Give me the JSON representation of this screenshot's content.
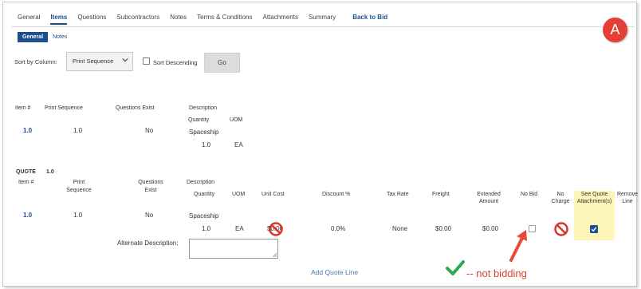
{
  "tabs": [
    {
      "label": "General"
    },
    {
      "label": "Items",
      "active": true
    },
    {
      "label": "Questions"
    },
    {
      "label": "Subcontractors"
    },
    {
      "label": "Notes"
    },
    {
      "label": "Terms & Conditions"
    },
    {
      "label": "Attachments"
    },
    {
      "label": "Summary"
    },
    {
      "label": "Back to Bid"
    }
  ],
  "subtabs": [
    {
      "label": "General",
      "active": true
    },
    {
      "label": "Notes"
    }
  ],
  "sort": {
    "label": "Sort by Column:",
    "selected": "Print Sequence",
    "descending_label": "Sort Descending",
    "descending_checked": false,
    "go_label": "Go"
  },
  "item_table": {
    "headers": {
      "item": "Item #",
      "print_sequence": "Print Sequence",
      "questions_exist": "Questions Exist",
      "description": "Description",
      "quantity": "Quantity",
      "uom": "UOM"
    },
    "row": {
      "item": "1.0",
      "print_sequence": "1.0",
      "questions_exist": "No",
      "description": "Spaceship",
      "quantity": "1.0",
      "uom": "EA"
    }
  },
  "quote": {
    "label": "QUOTE",
    "number": "1.0",
    "headers": {
      "item": "Item #",
      "print_seq_1": "Print",
      "print_seq_2": "Sequence",
      "questions_1": "Questions",
      "questions_2": "Exist",
      "description": "Description",
      "quantity": "Quantity",
      "uom": "UOM",
      "unit_cost": "Unit Cost",
      "discount": "Discount %",
      "tax_rate": "Tax Rate",
      "freight": "Freight",
      "extended_1": "Extended",
      "extended_2": "Amount",
      "no_bid": "No Bid",
      "no_charge_1": "No",
      "no_charge_2": "Charge",
      "see_quote_1": "See Quote",
      "see_quote_2": "Attachment(s)",
      "remove_1": "Remove",
      "remove_2": "Line"
    },
    "row": {
      "item": "1.0",
      "print_sequence": "1.0",
      "questions_exist": "No",
      "description": "Spaceship",
      "quantity": "1.0",
      "uom": "EA",
      "unit_cost": "$0.00",
      "discount": "0.0%",
      "tax_rate": "None",
      "freight": "$0.00",
      "extended": "$0.00",
      "no_bid_checked": false,
      "see_quote_checked": true
    },
    "alt_desc_label": "Alternate Description:",
    "add_line": "Add Quote Line"
  },
  "annotations": {
    "badge": "A",
    "not_bidding": "-- not bidding"
  },
  "colors": {
    "accent": "#1d4f8f",
    "highlight": "#fdf6b8",
    "badge": "#e53e34",
    "annotation": "#d64530",
    "check": "#2fa84f"
  }
}
